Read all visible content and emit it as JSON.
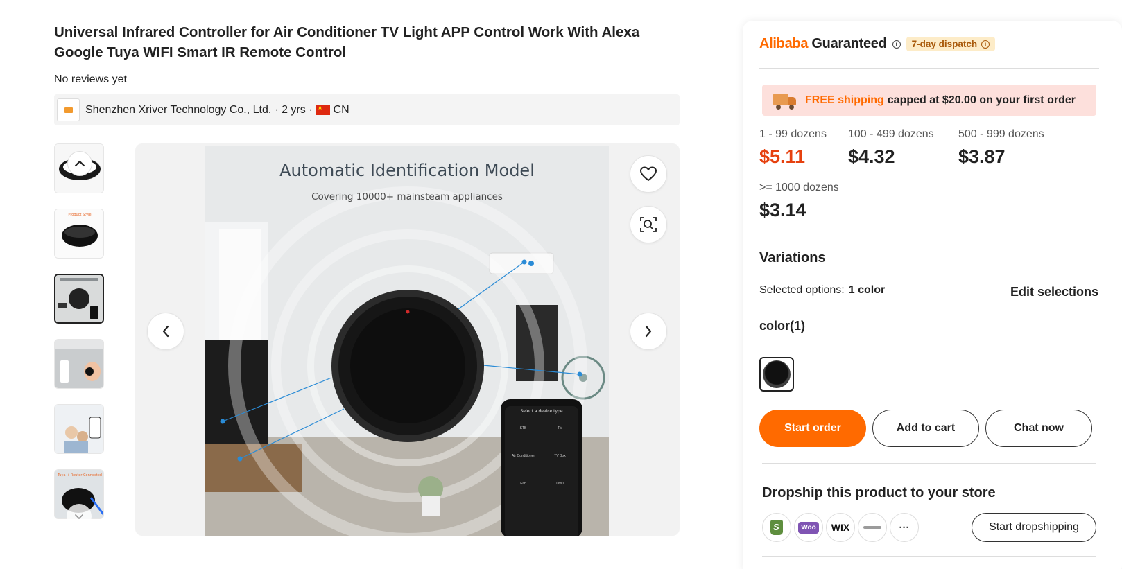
{
  "product": {
    "title": "Universal Infrared Controller for Air Conditioner TV Light APP Control Work With Alexa Google Tuya WIFI Smart IR Remote Control",
    "reviews": "No reviews yet"
  },
  "supplier": {
    "name": "Shenzhen Xriver Technology Co., Ltd.",
    "meta": "· 2 yrs ·",
    "country": "CN"
  },
  "gallery": {
    "thumbnail_count": 6,
    "active_index": 2,
    "image_title": "Automatic Identification Model",
    "image_subtitle": "Covering 10000+ mainsteam appliances",
    "phone_header": "Select a device type",
    "phone_items": [
      "STB",
      "TV",
      "Air Conditioner",
      "TV Box",
      "Fan",
      "DVD"
    ],
    "thumb1_text": "Product Style",
    "thumb6_text": "Tuya + Router Connected"
  },
  "purchase": {
    "guarantee_brand": "Alibaba",
    "guarantee_word": "Guaranteed",
    "dispatch": "7-day dispatch",
    "shipping_free": "FREE shipping",
    "shipping_rest": "capped at $20.00 on your first order",
    "tiers": [
      {
        "qty": "1 - 99 dozens",
        "price": "$5.11"
      },
      {
        "qty": "100 - 499 dozens",
        "price": "$4.32"
      },
      {
        "qty": "500 - 999 dozens",
        "price": "$3.87"
      },
      {
        "qty": ">= 1000 dozens",
        "price": "$3.14"
      }
    ],
    "variations_title": "Variations",
    "selected_label": "Selected options:",
    "selected_value": "1 color",
    "edit_label": "Edit selections",
    "color_label": "color(1)",
    "buttons": {
      "start_order": "Start order",
      "add_to_cart": "Add to cart",
      "chat_now": "Chat now"
    },
    "dropship_title": "Dropship this product to your store",
    "platforms": [
      "Shopify",
      "Woo",
      "WIX",
      "Squarespace",
      "more"
    ],
    "dropship_button": "Start dropshipping"
  },
  "colors": {
    "accent": "#ff6a00",
    "price_highlight": "#e6410f",
    "banner_bg": "#fde0dc",
    "dispatch_bg": "#fdecc8"
  }
}
